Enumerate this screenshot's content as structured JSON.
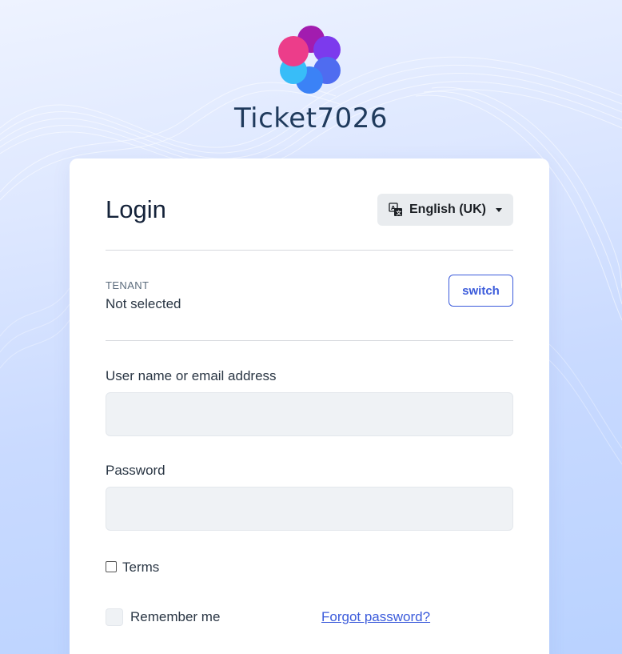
{
  "brand": {
    "name": "Ticket7026",
    "logo_colors": [
      "#ec3d8a",
      "#a21caf",
      "#7c3aed",
      "#4f6cf0",
      "#3b82f6",
      "#38bdf8"
    ]
  },
  "card": {
    "title": "Login",
    "language": {
      "selected": "English (UK)",
      "icon": "translate-icon"
    },
    "tenant": {
      "label": "TENANT",
      "value": "Not selected",
      "switch_label": "switch"
    },
    "fields": {
      "username_label": "User name or email address",
      "username_value": "",
      "password_label": "Password",
      "password_value": ""
    },
    "terms_label": "Terms",
    "remember_label": "Remember me",
    "forgot_label": "Forgot password?"
  },
  "colors": {
    "accent": "#3b5bdb",
    "input_bg": "#eff2f5",
    "title": "#15233a"
  }
}
